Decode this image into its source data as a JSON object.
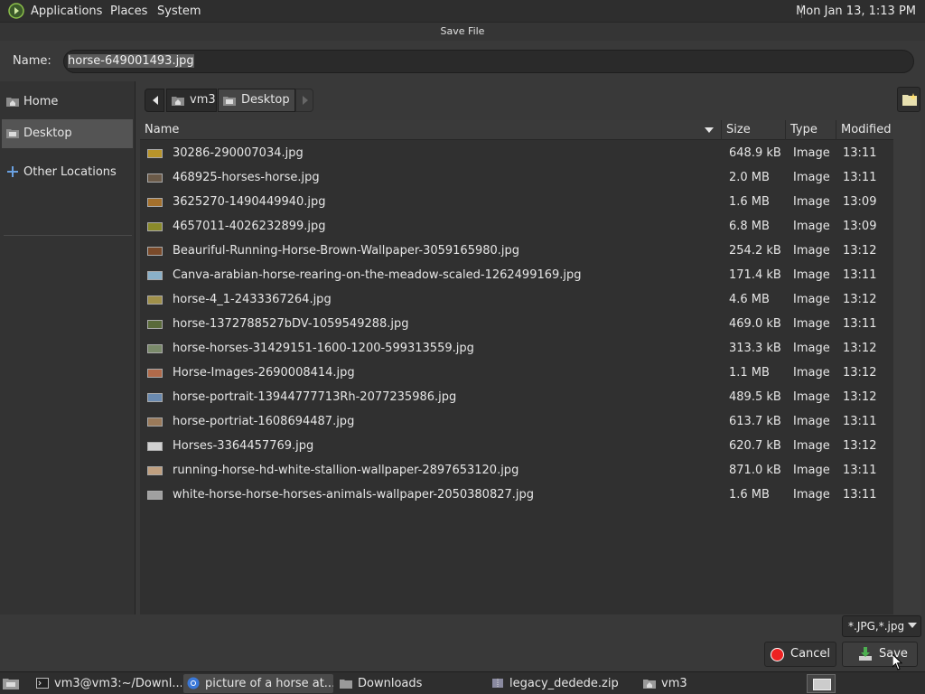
{
  "top_panel": {
    "menus": [
      "Applications",
      "Places",
      "System"
    ],
    "clock": "Mon Jan 13,  1:13 PM"
  },
  "dialog": {
    "title": "Save File",
    "name_label": "Name:",
    "name_value": "horse-649001493.jpg"
  },
  "sidebar": {
    "items": [
      {
        "label": "Home",
        "icon": "home-folder-icon"
      },
      {
        "label": "Desktop",
        "icon": "desktop-folder-icon",
        "active": true
      },
      {
        "label": "Other Locations",
        "icon": "plus-icon"
      }
    ]
  },
  "pathbar": {
    "crumbs": [
      "vm3",
      "Desktop"
    ]
  },
  "columns": [
    "Name",
    "Size",
    "Type",
    "Modified"
  ],
  "files": [
    {
      "name": "30286-290007034.jpg",
      "size": "648.9 kB",
      "type": "Image",
      "modified": "13:11",
      "color": "#b8942a"
    },
    {
      "name": "468925-horses-horse.jpg",
      "size": "2.0 MB",
      "type": "Image",
      "modified": "13:11",
      "color": "#6b5a48"
    },
    {
      "name": "3625270-1490449940.jpg",
      "size": "1.6 MB",
      "type": "Image",
      "modified": "13:09",
      "color": "#a4702c"
    },
    {
      "name": "4657011-4026232899.jpg",
      "size": "6.8 MB",
      "type": "Image",
      "modified": "13:09",
      "color": "#8a8a2a"
    },
    {
      "name": "Beauriful-Running-Horse-Brown-Wallpaper-3059165980.jpg",
      "size": "254.2 kB",
      "type": "Image",
      "modified": "13:12",
      "color": "#7a4a2a"
    },
    {
      "name": "Canva-arabian-horse-rearing-on-the-meadow-scaled-1262499169.jpg",
      "size": "171.4 kB",
      "type": "Image",
      "modified": "13:11",
      "color": "#8ab0c8"
    },
    {
      "name": "horse-4_1-2433367264.jpg",
      "size": "4.6 MB",
      "type": "Image",
      "modified": "13:12",
      "color": "#a0904a"
    },
    {
      "name": "horse-1372788527bDV-1059549288.jpg",
      "size": "469.0 kB",
      "type": "Image",
      "modified": "13:11",
      "color": "#5a6a3a"
    },
    {
      "name": "horse-horses-31429151-1600-1200-599313559.jpg",
      "size": "313.3 kB",
      "type": "Image",
      "modified": "13:12",
      "color": "#7a8a6a"
    },
    {
      "name": "Horse-Images-2690008414.jpg",
      "size": "1.1 MB",
      "type": "Image",
      "modified": "13:12",
      "color": "#b06a4a"
    },
    {
      "name": "horse-portrait-13944777713Rh-2077235986.jpg",
      "size": "489.5 kB",
      "type": "Image",
      "modified": "13:12",
      "color": "#6a8ab0"
    },
    {
      "name": "horse-portriat-1608694487.jpg",
      "size": "613.7 kB",
      "type": "Image",
      "modified": "13:11",
      "color": "#9a7a5a"
    },
    {
      "name": "Horses-3364457769.jpg",
      "size": "620.7 kB",
      "type": "Image",
      "modified": "13:12",
      "color": "#d0d0d0"
    },
    {
      "name": "running-horse-hd-white-stallion-wallpaper-2897653120.jpg",
      "size": "871.0 kB",
      "type": "Image",
      "modified": "13:11",
      "color": "#c0a080"
    },
    {
      "name": "white-horse-horse-horses-animals-wallpaper-2050380827.jpg",
      "size": "1.6 MB",
      "type": "Image",
      "modified": "13:11",
      "color": "#a0a0a0"
    }
  ],
  "filter": "*.JPG,*.jpg",
  "buttons": {
    "cancel": "Cancel",
    "save": "Save"
  },
  "taskbar": {
    "items": [
      {
        "label": "vm3@vm3:~/Downl...",
        "icon": "terminal-icon"
      },
      {
        "label": "picture of a horse at...",
        "icon": "chrome-icon",
        "active": true
      },
      {
        "label": "Downloads",
        "icon": "folder-icon"
      },
      {
        "label": "legacy_dedede.zip",
        "icon": "archive-icon"
      },
      {
        "label": "vm3",
        "icon": "home-folder-icon"
      }
    ]
  }
}
